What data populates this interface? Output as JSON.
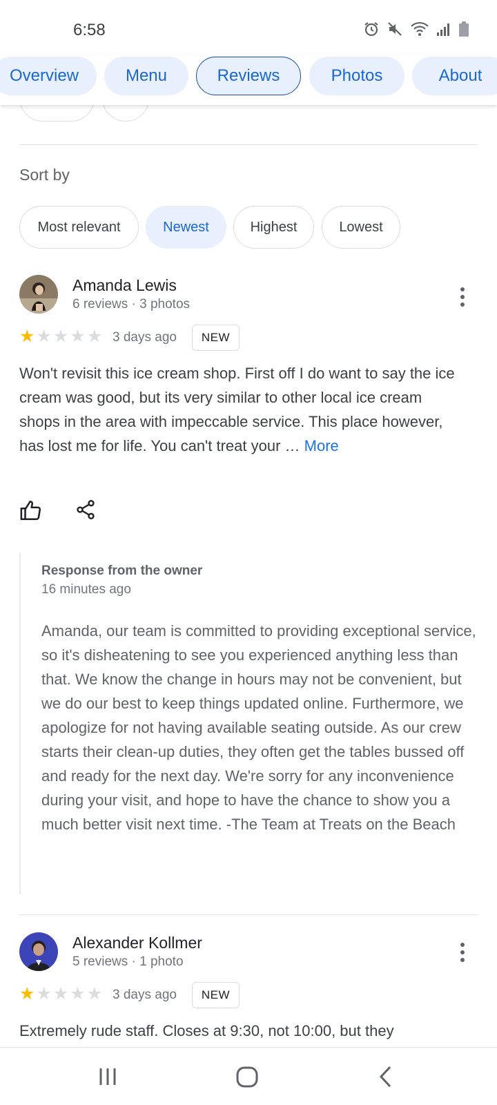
{
  "status_bar": {
    "time": "6:58",
    "icons": [
      "alarm-icon",
      "mute-icon",
      "wifi-icon",
      "signal-icon",
      "battery-icon"
    ]
  },
  "tabs": [
    {
      "label": "Overview",
      "active": false
    },
    {
      "label": "Menu",
      "active": false
    },
    {
      "label": "Reviews",
      "active": true
    },
    {
      "label": "Photos",
      "active": false
    },
    {
      "label": "About",
      "active": false
    }
  ],
  "sort": {
    "label": "Sort by",
    "options": [
      {
        "label": "Most relevant",
        "selected": false
      },
      {
        "label": "Newest",
        "selected": true
      },
      {
        "label": "Highest",
        "selected": false
      },
      {
        "label": "Lowest",
        "selected": false
      }
    ]
  },
  "reviews": [
    {
      "name": "Amanda Lewis",
      "meta": "6 reviews · 3 photos",
      "rating": 1,
      "date": "3 days ago",
      "badge": "NEW",
      "text": "Won't revisit this ice cream shop. First off I do want to say the ice cream was good, but its very similar to other local ice cream shops in the area with impeccable service. This place however, has lost me for life. You can't treat your … ",
      "more_label": "More",
      "owner_response": {
        "title": "Response from the owner",
        "time": "16 minutes ago",
        "text": "Amanda, our team is committed to providing exceptional service, so it's disheatening to see you experienced anything less than that. We know the change in hours may not be convenient, but we do our best to keep things updated online. Furthermore, we apologize for not having available seating outside. As our crew starts their clean-up duties, they often get the tables bussed off and ready for the next day. We're sorry for any inconvenience during your visit, and hope to have the chance to show you a much better visit next time. -The Team at Treats on the Beach"
      }
    },
    {
      "name": "Alexander Kollmer",
      "meta": "5 reviews · 1 photo",
      "rating": 1,
      "date": "3 days ago",
      "badge": "NEW",
      "text": "Extremely rude staff. Closes at 9:30, not 10:00, but they"
    }
  ],
  "colors": {
    "accent": "#1967d2",
    "chip_bg": "#e8f0fe",
    "star": "#fbbc04"
  }
}
